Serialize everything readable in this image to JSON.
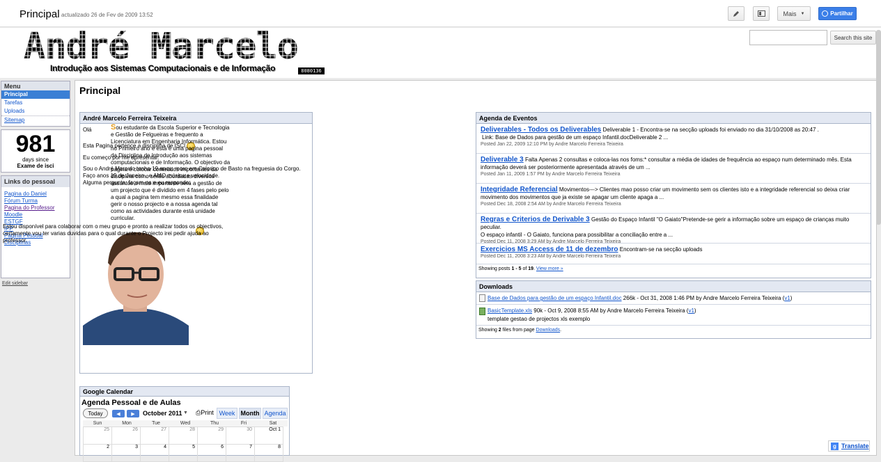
{
  "topbar": {
    "title": "Principal",
    "updated": "actualizado 26 de Fev de 2009 13:52",
    "more_label": "Mais",
    "share_label": "Partilhar",
    "edit_icon": "pencil-icon",
    "layout_icon": "layout-icon",
    "share_icon": "globe-icon"
  },
  "header": {
    "logo_text": "André Marcelo",
    "subtitle": "Introdução aos Sistemas Computacionais e de Informação",
    "code": "8080136",
    "search_placeholder": "",
    "search_button": "Search this site"
  },
  "sidebar": {
    "menu_title": "Menu",
    "menu_items": [
      "Principal",
      "Tarefas",
      "Uploads",
      "Sitemap"
    ],
    "count": "981",
    "count_line1": "days since",
    "count_line2": "Exame de isci",
    "links_title": "Links do pessoal",
    "links": [
      "Pagina do Daniel",
      "Fórum Turma",
      "Pagina do Professor",
      "Moodle",
      "ESTGF",
      "IPP",
      "Pagina Pessoal",
      "Disciplinas"
    ],
    "edit_sidebar": "Edit sidebar"
  },
  "main": {
    "title": "Principal"
  },
  "profile": {
    "title": "André Marcelo Ferreira Teixeira",
    "p1": "Olá",
    "p2": "Esta Pagina pertence a disciplina de ISCI",
    "p3": "Eu começo por me apresentar.",
    "p4a": "Sou o André Marcelo tenho 19 anos, moro em Celorico de Basto na freguesia do Corgo.",
    "p4b": "Faço anos 19 de Janeiro , e AMO música e velocidade.",
    "p4c": "Alguma pergunta, façam-na e eu respondo.",
    "float_first": "S",
    "float_text": "ou estudante da Escola Superior e  Tecnologia e Gestão de Felgueiras e frequento a Licenciatura em Engenharia Informática. Estou no Primeiro ano e está é uma pagina pessoal da Disciplina de Introdução aos sistemas computacionais e de Informação. O objectivo da pagina é colocar conteúdos importantes da disciplina como serão abordadas diversos assuntos o mais importante será a gestão de um projecto que é dividido em 4 fases pelo pelo a qual a pagina tem mesmo essa finalidade gerir o nosso projecto e a nossa agenda tal como as actividades durante está unidade curricular.",
    "bottom_text": "Estou disponível para colaborar com o meu grupo e pronto a realizar todos os objectivos, certamente vou ter varias duvidas para o qual durante o  Projecto irei pedir ajuda ao professor."
  },
  "agenda": {
    "title": "Agenda de Eventos",
    "posts": [
      {
        "title": "Deliverables - Todos os Deliverables",
        "snippet": "Deliverable 1 - Encontra-se na secção uploads foi enviado no dia 31/10/2008 as 20:47 .",
        "snippet2": "Link:  Base de Dados para gestão de um espaço Infantil.docDeliverable 2 ...",
        "meta": "Posted Jan 22, 2009 12:10 PM by Andre Marcelo Ferreira Teixeira"
      },
      {
        "title": "Deliverable 3",
        "snippet": "Falta Apenas 2 consultas e coloca-las nos foms:* consultar a média de idades de frequência ao espaço num determinado mês. Esta",
        "snippet2": "informação deverá ser posteriormente apresentada através de um ...",
        "meta": "Posted Jan 11, 2009 1:57 PM by Andre Marcelo Ferreira Teixeira"
      },
      {
        "title": "Integridade Referencial",
        "snippet": "Movimentos---> Clientes mao posso criar um movimento sem os clientes isto e a integridade referencial so deixa criar",
        "snippet2": "movimento dos movimentos que ja existe se apagar um cliente apaga a ...",
        "meta": "Posted Dec 18, 2008 2:54 AM by Andre Marcelo Ferreira Teixeira"
      },
      {
        "title": "Regras e Criterios de Derivable 3",
        "snippet": "Gestão do Espaço Infantil \"O Gaiato\"Pretende-se gerir a informação sobre um espaço de crianças muito peculiar.",
        "snippet2": "O espaço infantil - O Gaiato, funciona para possibilitar a conciliação entre a ...",
        "meta": "Posted Dec 11, 2008 3:29 AM by Andre Marcelo Ferreira Teixeira"
      },
      {
        "title": "Exercicios MS Access de 11 de dezembro",
        "snippet": "Encontram-se na secção uploads",
        "snippet2": "",
        "meta": "Posted Dec 11, 2008 3:23 AM by Andre Marcelo Ferreira Teixeira"
      }
    ],
    "footer_prefix": "Showing posts ",
    "footer_range": "1 - 5",
    "footer_of": " of ",
    "footer_total": "19",
    "footer_end": ". ",
    "view_more": "View more »"
  },
  "downloads": {
    "title": "Downloads",
    "files": [
      {
        "name": "Base de Dados para gestão de um espaço Infantil.doc",
        "info": " 266k - Oct 31, 2008 1:46 PM by Andre Marcelo Ferreira Teixeira (",
        "version": "v1",
        "close": ")",
        "desc": ""
      },
      {
        "name": "BasicTemplate.xls",
        "info": " 90k - Oct 9, 2008 8:55 AM by Andre Marcelo Ferreira Teixeira (",
        "version": "v1",
        "close": ")",
        "desc": "template gestao de projectos xls exemplo"
      }
    ],
    "footer_prefix": "Showing ",
    "footer_count": "2",
    "footer_mid": " files from page ",
    "footer_link": "Downloads",
    "footer_end": "."
  },
  "calendar": {
    "gadget_title": "Google Calendar",
    "title": "Agenda Pessoal e de Aulas",
    "today": "Today",
    "month": "October 2011",
    "print": "Print",
    "week": "Week",
    "month_view": "Month",
    "agenda": "Agenda",
    "days": [
      "Sun",
      "Mon",
      "Tue",
      "Wed",
      "Thu",
      "Fri",
      "Sat"
    ],
    "row1": [
      "25",
      "26",
      "27",
      "28",
      "29",
      "30",
      "Oct 1"
    ],
    "row2": [
      "2",
      "3",
      "4",
      "5",
      "6",
      "7",
      "8"
    ]
  },
  "translate": "Translate"
}
